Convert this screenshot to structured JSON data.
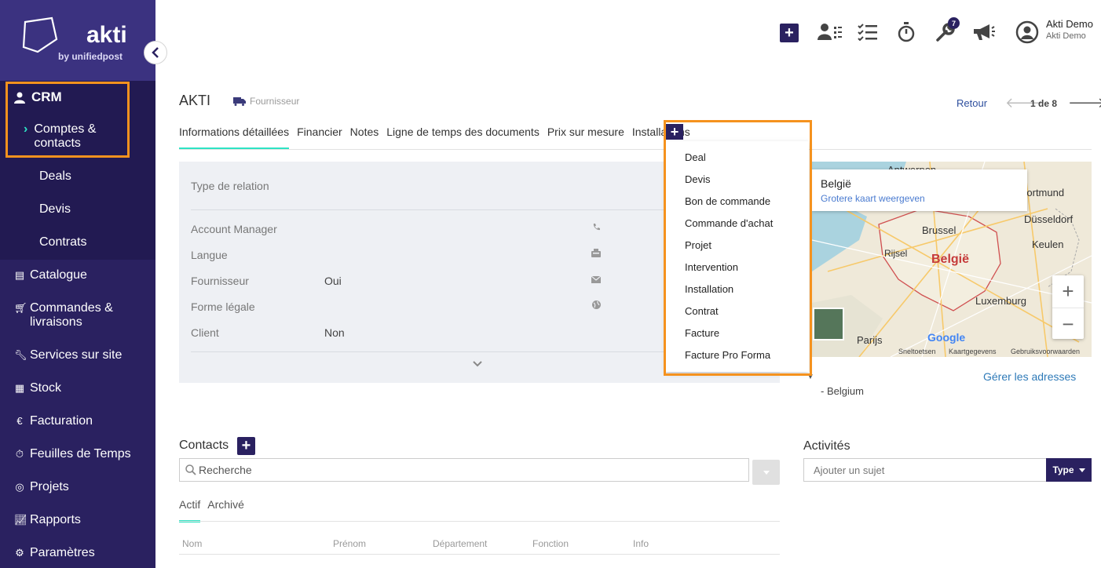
{
  "brand": {
    "name": "akti",
    "tagline": "by unifiedpost"
  },
  "sidebar": {
    "crm": {
      "label": "CRM",
      "icon": "user-icon"
    },
    "crm_items": [
      {
        "label": "Comptes & contacts",
        "active": true
      },
      {
        "label": "Deals"
      },
      {
        "label": "Devis"
      },
      {
        "label": "Contrats"
      }
    ],
    "items": [
      {
        "label": "Catalogue",
        "icon": "book-icon"
      },
      {
        "label": "Commandes & livraisons",
        "icon": "cart-icon"
      },
      {
        "label": "Services sur site",
        "icon": "wrench-icon"
      },
      {
        "label": "Stock",
        "icon": "boxes-icon"
      },
      {
        "label": "Facturation",
        "icon": "euro-icon"
      },
      {
        "label": "Feuilles de Temps",
        "icon": "stopwatch-icon"
      },
      {
        "label": "Projets",
        "icon": "target-icon"
      },
      {
        "label": "Rapports",
        "icon": "chart-icon"
      },
      {
        "label": "Paramètres",
        "icon": "gear-icon"
      }
    ]
  },
  "topbar": {
    "notification_count": "7",
    "user": {
      "name": "Akti Demo",
      "org": "Akti Demo"
    }
  },
  "record": {
    "title": "AKTI",
    "type_label": "Fournisseur",
    "back_label": "Retour",
    "pager": "1 de 8"
  },
  "tabs": [
    "Informations détaillées",
    "Financier",
    "Notes",
    "Ligne de temps des documents",
    "Prix sur mesure",
    "Installations"
  ],
  "info": {
    "relation_label": "Type de relation",
    "fields": [
      {
        "label": "Account Manager",
        "value": "",
        "icon": "phone-icon"
      },
      {
        "label": "Langue",
        "value": "",
        "icon": "fax-icon"
      },
      {
        "label": "Fournisseur",
        "value": "Oui",
        "icon": "envelope-icon"
      },
      {
        "label": "Forme légale",
        "value": "",
        "icon": "globe-icon"
      },
      {
        "label": "Client",
        "value": "Non",
        "icon": ""
      }
    ]
  },
  "dropdown": [
    "Deal",
    "Devis",
    "Bon de commande",
    "Commande d'achat",
    "Projet",
    "Intervention",
    "Installation",
    "Contrat",
    "Facture",
    "Facture Pro Forma"
  ],
  "map": {
    "title": "België",
    "link": "Grotere kaart weergeven",
    "cities": [
      "Dortmund",
      "Düsseldorf",
      "Brussel",
      "België",
      "Keulen",
      "Luxemburg",
      "Parijs",
      "Rijsel",
      "Antwerpen"
    ],
    "footer": [
      "Sneltoetsen",
      "Kaartgegevens",
      "Gebruiksvoorwaarden"
    ],
    "google": "Google",
    "manage_link": "Gérer les adresses",
    "address": "- Belgium"
  },
  "contacts": {
    "title": "Contacts",
    "search_placeholder": "Recherche",
    "subtabs": [
      "Actif",
      "Archivé"
    ],
    "columns": [
      "Nom",
      "Prénom",
      "Département",
      "Fonction",
      "Info"
    ]
  },
  "activities": {
    "title": "Activités",
    "input_placeholder": "Ajouter un sujet",
    "type_label": "Type"
  },
  "colors": {
    "brand": "#2a2160",
    "accent": "#2ee3c4",
    "highlight": "#f5921e",
    "link": "#2e7ab8"
  }
}
